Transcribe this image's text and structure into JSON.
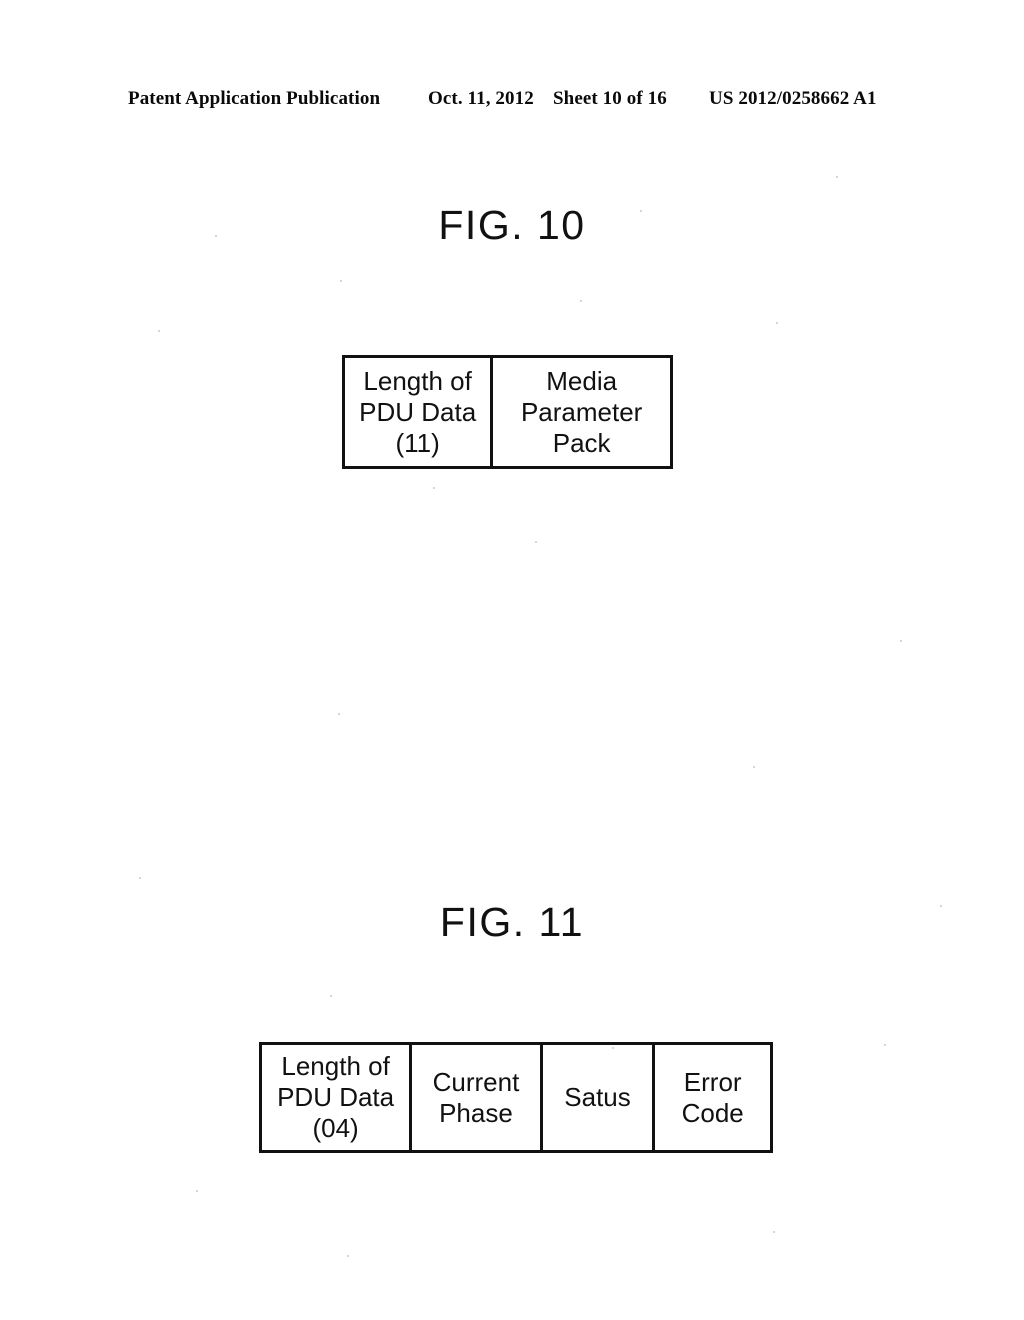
{
  "header": {
    "publication": "Patent Application Publication",
    "date": "Oct. 11, 2012",
    "sheet": "Sheet 10 of 16",
    "document_number": "US 2012/0258662 A1"
  },
  "figures": [
    {
      "title": "FIG. 10",
      "cells": [
        {
          "text": "Length of\nPDU Data\n(11)"
        },
        {
          "text": "Media\nParameter\nPack"
        }
      ]
    },
    {
      "title": "FIG. 11",
      "cells": [
        {
          "text": "Length of\nPDU Data\n(04)"
        },
        {
          "text": "Current\nPhase"
        },
        {
          "text": "Satus"
        },
        {
          "text": "Error\nCode"
        }
      ]
    }
  ],
  "style": {
    "ink_color": "#111111",
    "page_color": "#ffffff"
  }
}
